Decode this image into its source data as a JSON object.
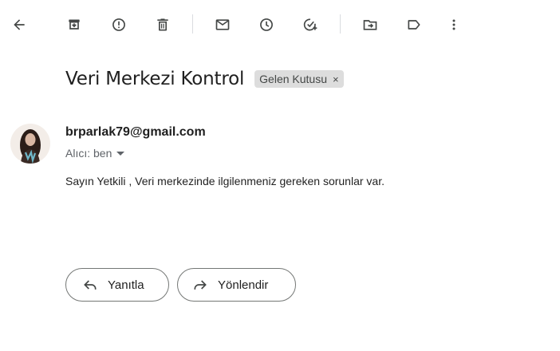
{
  "toolbar": {
    "icons": [
      "back-arrow-icon",
      "archive-icon",
      "report-spam-icon",
      "delete-icon",
      "mark-unread-icon",
      "snooze-icon",
      "add-task-icon",
      "move-to-icon",
      "label-icon",
      "more-vert-icon"
    ]
  },
  "email": {
    "subject": "Veri Merkezi Kontrol",
    "label_chip": "Gelen Kutusu",
    "label_chip_close": "×",
    "sender": "brparlak79@gmail.com",
    "recipient": "Alıcı: ben",
    "body": "Sayın Yetkili , Veri merkezinde ilgilenmeniz gereken sorunlar var."
  },
  "actions": {
    "reply_label": "Yanıtla",
    "forward_label": "Yönlendir"
  },
  "colors": {
    "icon": "#444746",
    "chip_bg": "#dddddd",
    "button_border": "#747775"
  }
}
